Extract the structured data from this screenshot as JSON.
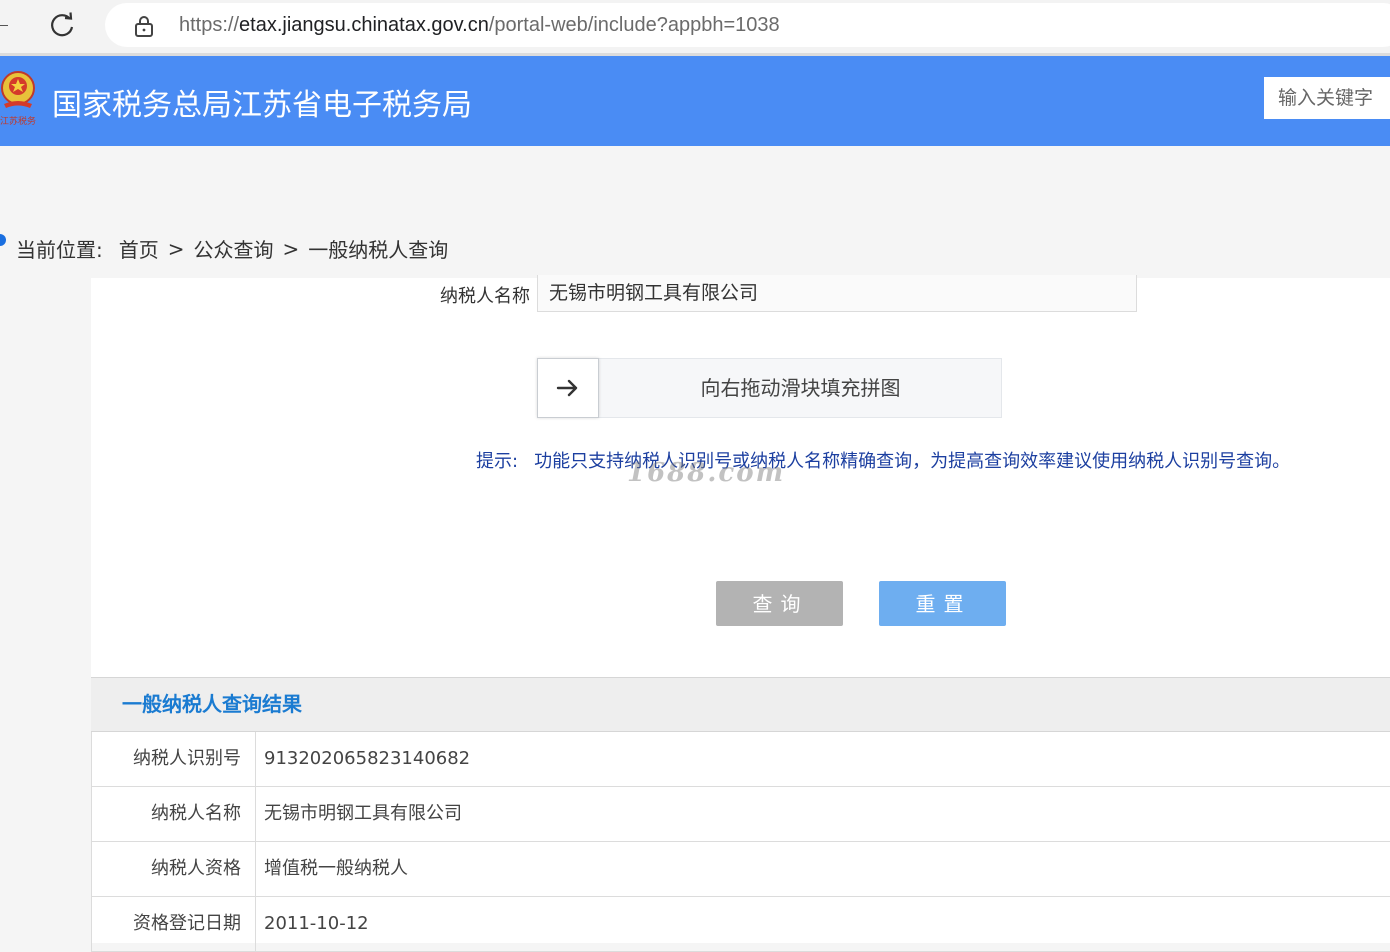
{
  "browser": {
    "url_scheme": "https://",
    "url_host": "etax.jiangsu.chinatax.gov.cn",
    "url_path": "/portal-web/include?appbh=1038"
  },
  "header": {
    "emblem_caption": "江苏税务",
    "title": "国家税务总局江苏省电子税务局",
    "search_placeholder": "输入关键字"
  },
  "breadcrumb": {
    "label": "当前位置:",
    "items": [
      "首页",
      "公众查询",
      "一般纳税人查询"
    ],
    "separator": ">"
  },
  "form": {
    "name_label": "纳税人名称",
    "name_value": "无锡市明钢工具有限公司",
    "slider_text": "向右拖动滑块填充拼图",
    "hint_label": "提示:",
    "hint_text": "功能只支持纳税人识别号或纳税人名称精确查询，为提高查询效率建议使用纳税人识别号查询。",
    "watermark": "1688.com",
    "query_button": "查询",
    "reset_button": "重置"
  },
  "results": {
    "title": "一般纳税人查询结果",
    "rows": [
      {
        "label": "纳税人识别号",
        "value": "913202065823140682"
      },
      {
        "label": "纳税人名称",
        "value": "无锡市明钢工具有限公司"
      },
      {
        "label": "纳税人资格",
        "value": "增值税一般纳税人"
      },
      {
        "label": "资格登记日期",
        "value": "2011-10-12"
      }
    ]
  },
  "colors": {
    "header_bg": "#4a8cf4",
    "result_title": "#1a7bd1",
    "hint_text": "#1c3fa0",
    "reset_button": "#6eaef0",
    "query_button": "#b3b3b3"
  }
}
